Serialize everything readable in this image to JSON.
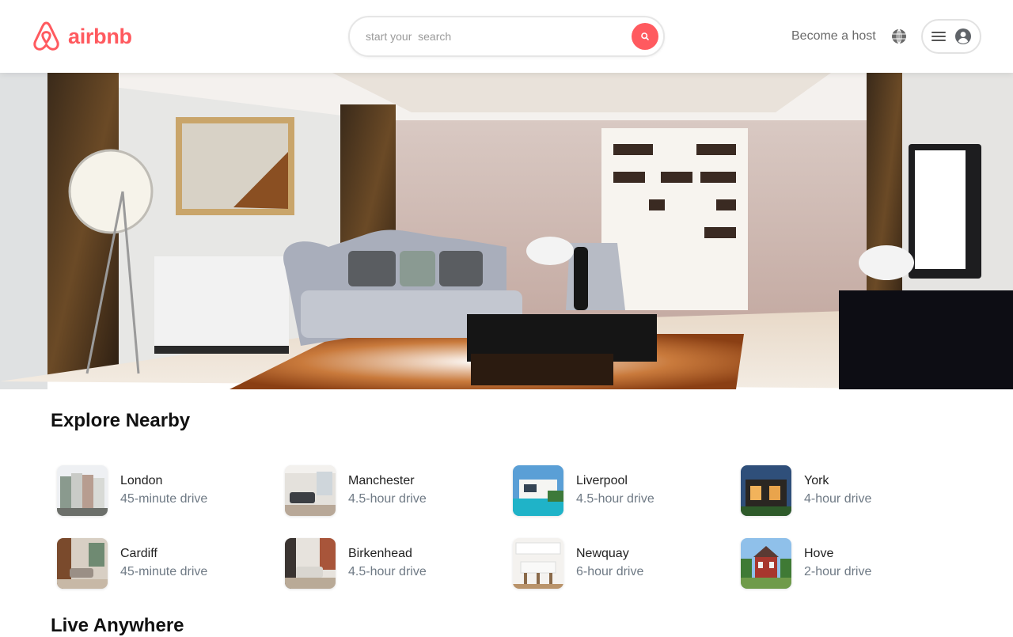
{
  "header": {
    "brand": "airbnb",
    "search": {
      "placeholder": "start your  search",
      "value": ""
    },
    "host_link": "Become a host"
  },
  "colors": {
    "brand": "#FF5A5F",
    "muted_text": "#6f7a85"
  },
  "icons": {
    "logo": "airbnb-belo-icon",
    "search": "search-icon",
    "globe": "globe-icon",
    "menu": "hamburger-icon",
    "user": "user-avatar-icon"
  },
  "hero": {
    "image": "luxury-living-room"
  },
  "explore": {
    "title": "Explore Nearby",
    "items": [
      {
        "name": "London",
        "distance": "45-minute drive",
        "image": "townhouses"
      },
      {
        "name": "Manchester",
        "distance": "4.5-hour drive",
        "image": "living-room"
      },
      {
        "name": "Liverpool",
        "distance": "4.5-hour drive",
        "image": "modern-villa-pool"
      },
      {
        "name": "York",
        "distance": "4-hour drive",
        "image": "modern-house-night"
      },
      {
        "name": "Cardiff",
        "distance": "45-minute drive",
        "image": "interior-lounge"
      },
      {
        "name": "Birkenhead",
        "distance": "4.5-hour drive",
        "image": "living-room-brick"
      },
      {
        "name": "Newquay",
        "distance": "6-hour drive",
        "image": "white-kitchen"
      },
      {
        "name": "Hove",
        "distance": "2-hour drive",
        "image": "red-brick-house"
      }
    ]
  },
  "live": {
    "title": "Live Anywhere"
  }
}
